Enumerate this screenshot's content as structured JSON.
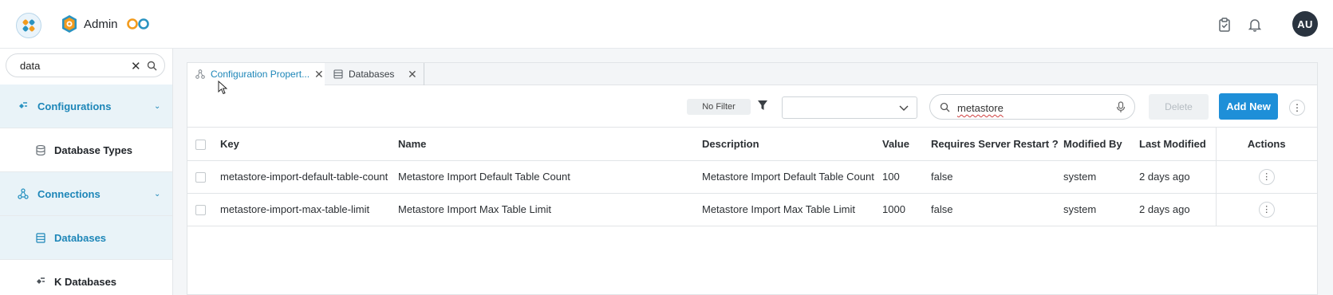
{
  "header": {
    "brand_label": "Admin",
    "avatar_initials": "AU",
    "icons": [
      "app-logo-icon",
      "admin-shield-icon",
      "qo-logo-icon",
      "clipboard-check-icon",
      "bell-icon"
    ]
  },
  "sidebar": {
    "search": {
      "value": "data"
    },
    "items": [
      {
        "label": "Configurations",
        "type": "group",
        "icon": "plug-icon"
      },
      {
        "label": "Database Types",
        "type": "sub",
        "icon": "database-icon"
      },
      {
        "label": "Connections",
        "type": "group",
        "icon": "network-icon"
      },
      {
        "label": "Databases",
        "type": "sub-active",
        "icon": "database-icon"
      },
      {
        "label": "K Databases",
        "type": "sub",
        "icon": "plug-icon"
      }
    ]
  },
  "tabs": [
    {
      "label": "Configuration Propert...",
      "active": true
    },
    {
      "label": "Databases",
      "active": false
    }
  ],
  "toolbar": {
    "filter_label": "No Filter",
    "select_value": "",
    "search_value": "metastore",
    "delete_label": "Delete",
    "add_label": "Add New"
  },
  "table": {
    "headers": [
      "Key",
      "Name",
      "Description",
      "Value",
      "Requires Server Restart ?",
      "Modified By",
      "Last Modified",
      "Actions"
    ],
    "rows": [
      [
        "metastore-import-default-table-count",
        "Metastore Import Default Table Count",
        "Metastore Import Default Table Count",
        "100",
        "false",
        "system",
        "2 days ago"
      ],
      [
        "metastore-import-max-table-limit",
        "Metastore Import Max Table Limit",
        "Metastore Import Max Table Limit",
        "1000",
        "false",
        "system",
        "2 days ago"
      ]
    ]
  },
  "colors": {
    "accent": "#1d86b8",
    "primary_button": "#1e8fd8",
    "avatar_bg": "#2a3440",
    "sidebar_active_bg": "#e9f3f8"
  }
}
